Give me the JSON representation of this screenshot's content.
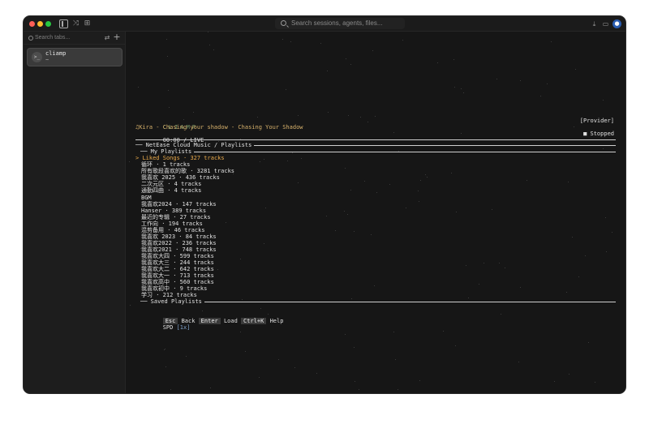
{
  "titlebar": {
    "search_placeholder": "Search sessions, agents, files...",
    "icons": [
      "sidebar-icon",
      "shuffle-icon",
      "grid-icon",
      "download-icon",
      "inbox-icon",
      "avatar"
    ]
  },
  "sidebar": {
    "search_placeholder": "Search tabs...",
    "tabs": [
      {
        "title": "cliamp",
        "subtitle": "~"
      }
    ]
  },
  "terminal": {
    "brand": "CLIAMP",
    "provider_label": "[Provider]",
    "now_playing": "♫Kira - Chasing your shadow - Chasing Your Shadow",
    "time": "00:00 / LIVE",
    "status": "■ Stopped",
    "section_title": "NetEase Cloud Music / Playlists",
    "my_playlists_title": "My Playlists",
    "saved_playlists_title": "Saved Playlists",
    "cursor": ">",
    "playlists": [
      "Liked Songs · 327 tracks",
      "循环 · 1 tracks",
      "所有歌段喜欢的歌 · 3281 tracks",
      "我喜欢 2025 · 436 tracks",
      "二次元区 · 4 tracks",
      "通勤四曲 · 4 tracks",
      "BGM",
      "我喜欢2024 · 147 tracks",
      "Hanser · 389 tracks",
      "最近的专辑 · 27 tracks",
      "工作向 · 194 tracks",
      "混剪备用 · 46 tracks",
      "我喜欢 2023 · 84 tracks",
      "我喜欢2022 · 236 tracks",
      "我喜欢2021 · 748 tracks",
      "我喜欢大四 · 599 tracks",
      "我喜欢大三 · 244 tracks",
      "我喜欢大二 · 642 tracks",
      "我喜欢大一 · 713 tracks",
      "我喜欢高中 · 560 tracks",
      "我喜欢初中 · 9 tracks",
      "学习 · 212 tracks"
    ],
    "keys": [
      {
        "key": "Esc",
        "action": "Back"
      },
      {
        "key": "Enter",
        "action": "Load"
      },
      {
        "key": "Ctrl+K",
        "action": "Help"
      }
    ],
    "spd_label": "SPD",
    "spd_value": "[1x]"
  }
}
